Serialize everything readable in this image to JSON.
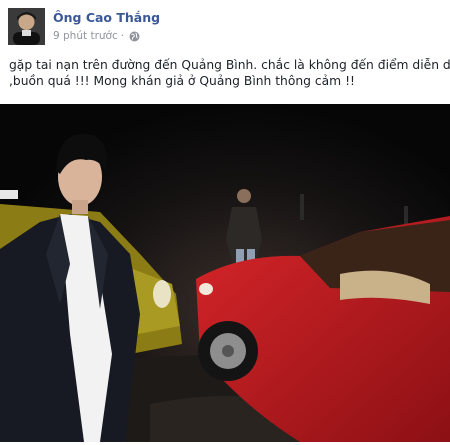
{
  "post": {
    "author_name": "Ông Cao Thắng",
    "timestamp": "9 phút trước",
    "privacy_icon": "globe-icon",
    "text_line_1": "gặp tai nạn trên đường đến Quảng Bình. chắc là không đến điểm diễn dc",
    "text_line_2": ",buồn quá !!! Mong khán giả ở Quảng Bình thông cảm !!"
  },
  "colors": {
    "author_link": "#3b5998",
    "meta_text": "#90949c",
    "body_text": "#1d2129",
    "car_red": "#b3191c",
    "car_yellow": "#9a8a1a"
  }
}
